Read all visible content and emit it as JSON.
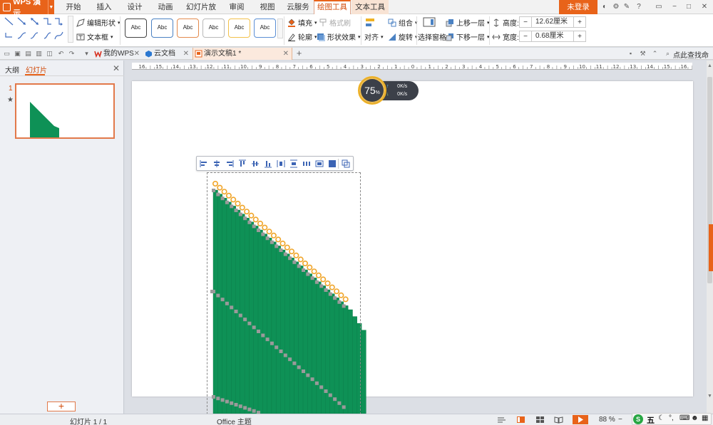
{
  "colors": {
    "accent": "#e8631a",
    "shape_green": "#0e9156",
    "handle_gray": "#9a9a9a",
    "handle_orange": "#f0a52a"
  },
  "menubar": {
    "app_name": "WPS 演示",
    "tabs": [
      {
        "label": "开始"
      },
      {
        "label": "插入"
      },
      {
        "label": "设计"
      },
      {
        "label": "动画"
      },
      {
        "label": "幻灯片放映"
      },
      {
        "label": "审阅"
      },
      {
        "label": "视图"
      },
      {
        "label": "云服务"
      },
      {
        "label": "绘图工具"
      },
      {
        "label": "文本工具"
      }
    ],
    "login_label": "未登录",
    "help_label": "?"
  },
  "ribbon": {
    "edit_shape": "编辑形状",
    "text_box": "文本框",
    "style_label": "Abc",
    "fill": "填充",
    "format_painter": "格式刷",
    "outline": "轮廓",
    "shape_effects": "形状效果",
    "align": "对齐",
    "group": "组合",
    "rotate": "旋转",
    "selection_pane": "选择窗格",
    "bring_forward": "上移一层",
    "send_backward": "下移一层",
    "height_label": "高度:",
    "height_value": "12.62厘米",
    "width_label": "宽度:",
    "width_value": "0.68厘米",
    "minus": "−",
    "plus": "+"
  },
  "doc_tabs": [
    {
      "label": "我的WPS"
    },
    {
      "label": "云文档"
    },
    {
      "label": "演示文稿1 *"
    }
  ],
  "help_search": "点此查找命令",
  "left_panel": {
    "tab_outline": "大纲",
    "tab_slides": "幻灯片",
    "slide_number": "1",
    "add_label": "+"
  },
  "perf_widget": {
    "percent": "75",
    "percent_unit": "%",
    "up_rate": "0K/s",
    "down_rate": "0K/s"
  },
  "ruler_labels": [
    "16",
    "15",
    "14",
    "13",
    "12",
    "11",
    "10",
    "9",
    "8",
    "7",
    "6",
    "5",
    "4",
    "3",
    "2",
    "1",
    "0",
    "1",
    "2",
    "3",
    "4",
    "5",
    "6",
    "7",
    "8",
    "9",
    "10",
    "11",
    "12",
    "13",
    "14",
    "15",
    "16"
  ],
  "statusbar": {
    "slide_position": "幻灯片 1 / 1",
    "theme": "Office 主题",
    "zoom": "88 %",
    "ime_label": "五"
  }
}
